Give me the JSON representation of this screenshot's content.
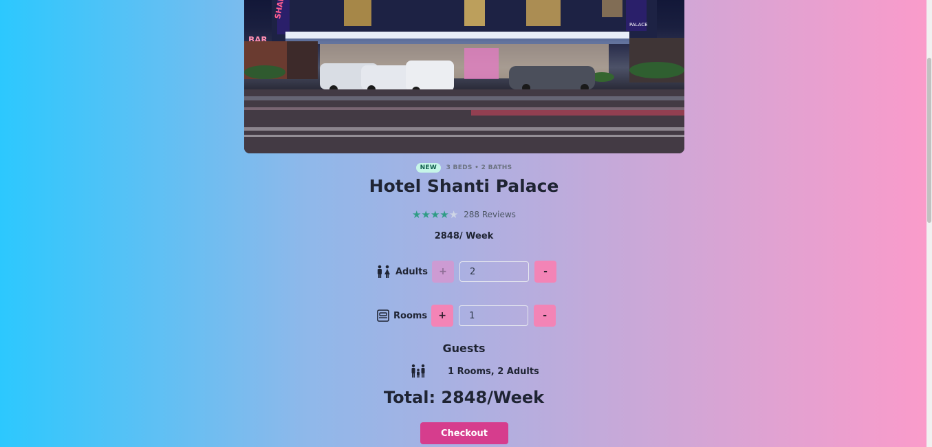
{
  "listing": {
    "badge": "NEW",
    "meta": "3 BEDS • 2 BATHS",
    "title": "Hotel Shanti Palace",
    "rating_value": 4,
    "rating_max": 5,
    "reviews": "288 Reviews",
    "price": "2848/ Week"
  },
  "hero_signage": {
    "left_sign": "SHANTI",
    "right_sign": "PALACE",
    "bar_sign": "BAR"
  },
  "adults": {
    "label": "Adults",
    "plus_label": "+",
    "minus_label": "-",
    "value": "2"
  },
  "rooms": {
    "label": "Rooms",
    "plus_label": "+",
    "minus_label": "-",
    "value": "1"
  },
  "guests": {
    "title": "Guests",
    "summary": "1 Rooms, 2 Adults"
  },
  "total": "Total: 2848/Week",
  "checkout_label": "Checkout",
  "colors": {
    "accent": "#d63d8d",
    "button_pink": "#f384b6",
    "star": "#2f9c85",
    "badge_bg": "#c6f6e8"
  }
}
